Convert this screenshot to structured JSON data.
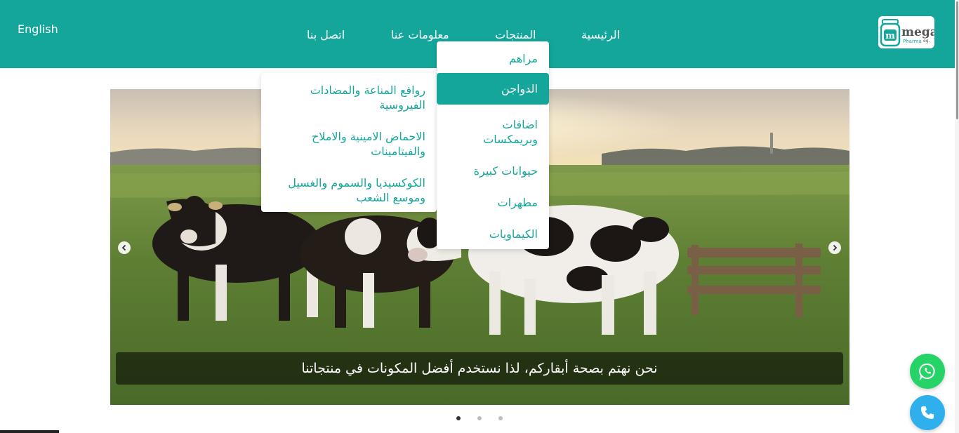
{
  "header": {
    "language_label": "English",
    "nav": [
      {
        "label": "الرئيسية"
      },
      {
        "label": "المنتجات"
      },
      {
        "label": "معلومات عنا"
      },
      {
        "label": "اتصل بنا"
      }
    ],
    "logo": {
      "brand": "mega",
      "sub": "Pharma",
      "suffix": "eg."
    }
  },
  "products_menu": {
    "items": [
      {
        "label": "مراهم"
      },
      {
        "label": "الدواجن",
        "active": true
      },
      {
        "label": "اضافات وبريمكسات"
      },
      {
        "label": "حيوانات كبيرة"
      },
      {
        "label": "مطهرات"
      },
      {
        "label": "الكيماويات"
      }
    ]
  },
  "poultry_submenu": {
    "items": [
      {
        "label": "روافع المناعة والمضادات الفيروسية"
      },
      {
        "label": "الاحماض الامينية والاملاح والفيتامينات"
      },
      {
        "label": "الكوكسيديا والسموم والغسيل وموسع الشعب"
      }
    ]
  },
  "slider": {
    "caption": "نحن نهتم بصحة أبقاركم، لذا نستخدم أفضل المكونات في منتجاتنا",
    "slide_count": 3,
    "active_slide": 1
  },
  "colors": {
    "brand": "#14a69b",
    "whatsapp": "#25d366",
    "phone": "#2fb0ec"
  },
  "icons": [
    "chevron-left-icon",
    "chevron-right-icon",
    "whatsapp-icon",
    "phone-icon"
  ]
}
